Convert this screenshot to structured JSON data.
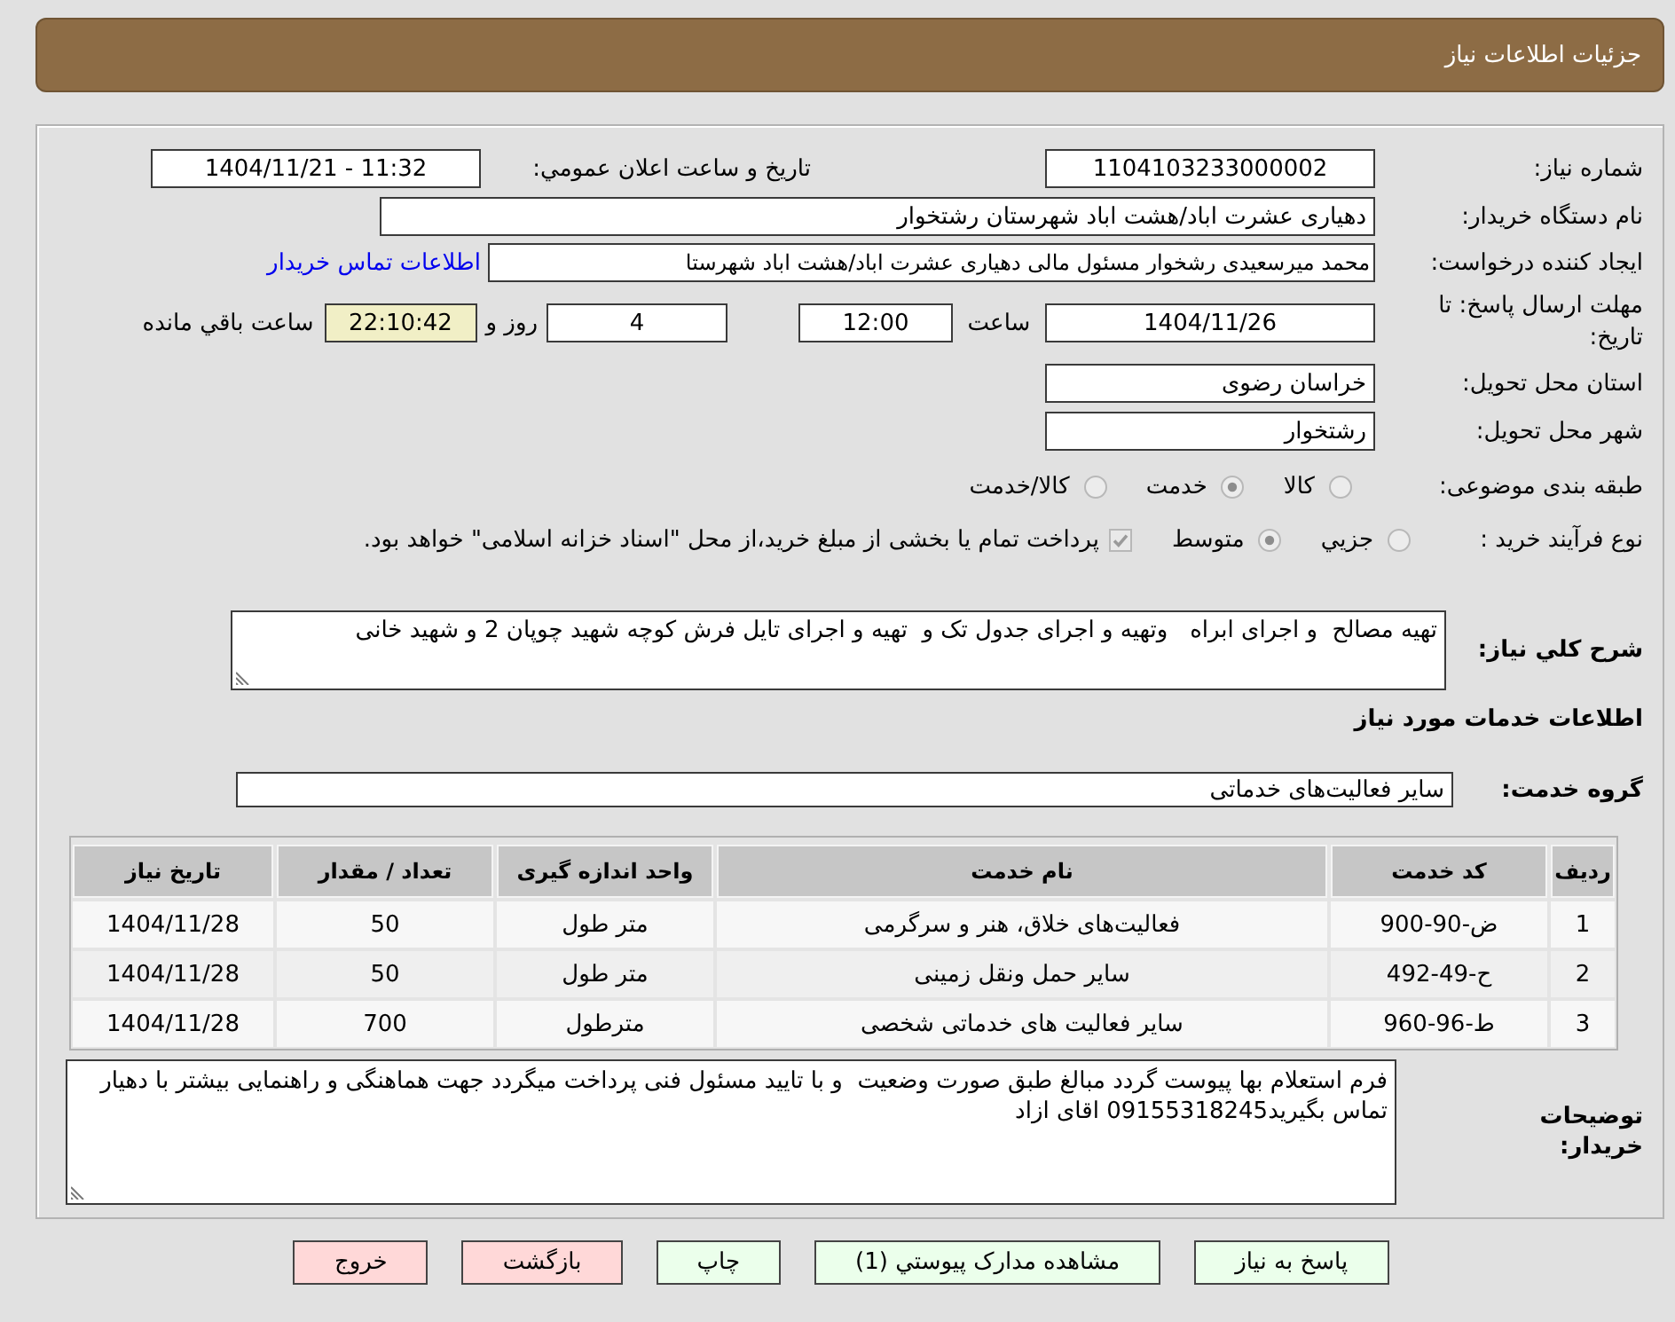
{
  "header": {
    "title": "جزئيات اطلاعات نياز"
  },
  "form": {
    "need_number": {
      "label": "شماره نياز:",
      "value": "1104103233000002"
    },
    "announce_datetime": {
      "label": "تاريخ و ساعت اعلان عمومي:",
      "value": "1404/11/21 - 11:32"
    },
    "buyer_org": {
      "label": "نام دستگاه خريدار:",
      "value": "دهياری عشرت اباد/هشت اباد شهرستان رشتخوار"
    },
    "requester": {
      "label": "ايجاد کننده درخواست:",
      "value": "محمد ميرسعيدی رشخوار مسئول مالی دهياری عشرت اباد/هشت اباد شهرستا",
      "contact_link": "اطلاعات تماس خريدار"
    },
    "deadline": {
      "label": "مهلت ارسال پاسخ: تا تاريخ:",
      "date": "1404/11/26",
      "time_label": "ساعت",
      "time": "12:00",
      "days": "4",
      "days_label": "روز و",
      "remaining_time": "22:10:42",
      "remaining_label": "ساعت باقي مانده"
    },
    "province": {
      "label": "استان محل تحويل:",
      "value": "خراسان رضوی"
    },
    "city": {
      "label": "شهر محل تحويل:",
      "value": "رشتخوار"
    },
    "category": {
      "label": "طبقه بندی موضوعی:",
      "disabled": true,
      "options": [
        {
          "label": "کالا",
          "selected": false
        },
        {
          "label": "خدمت",
          "selected": true
        },
        {
          "label": "کالا/خدمت",
          "selected": false
        }
      ]
    },
    "process": {
      "label": "نوع فرآيند خريد :",
      "disabled": true,
      "options": [
        {
          "label": "جزيي",
          "selected": false
        },
        {
          "label": "متوسط",
          "selected": true
        }
      ],
      "treasury": {
        "label": "پرداخت تمام يا بخشی از مبلغ خريد،از محل \"اسناد خزانه اسلامی\" خواهد بود.",
        "checked": true
      }
    },
    "description": {
      "label": "شرح کلي نياز:",
      "value": "تهيه مصالح  و اجرای ابراه   وتهيه و اجرای جدول تک و  تهيه و اجرای تايل فرش کوچه شهيد چوپان 2 و شهيد خانی"
    }
  },
  "services": {
    "title": "اطلاعات خدمات مورد نياز",
    "group": {
      "label": "گروه خدمت:",
      "value": "ساير فعاليت‌هاى خدماتى"
    },
    "table": {
      "columns": [
        "رديف",
        "کد خدمت",
        "نام خدمت",
        "واحد اندازه گيری",
        "تعداد / مقدار",
        "تاريخ نياز"
      ],
      "rows": [
        [
          "1",
          "ض-90-900",
          "فعاليت‌هاى خلاق، هنر و سرگرمى",
          "متر طول",
          "50",
          "1404/11/28"
        ],
        [
          "2",
          "ح-49-492",
          "ساير حمل ونقل زمينى",
          "متر طول",
          "50",
          "1404/11/28"
        ],
        [
          "3",
          "ط-96-960",
          "ساير فعاليت هاى خدماتى شخصى",
          "مترطول",
          "700",
          "1404/11/28"
        ]
      ]
    }
  },
  "buyer_notes": {
    "label": "توضيحات خريدار:",
    "value": "فرم استعلام بها پيوست گردد مبالغ طبق صورت وضعيت  و با تاييد مسئول فنی پرداخت ميگردد جهت هماهنگی و راهنمايی بيشتر با دهيار تماس بگيريد09155318245 اقای ازاد"
  },
  "buttons": [
    {
      "label": "پاسخ به نياز",
      "kind": "action"
    },
    {
      "label": "مشاهده مدارک پيوستي (1)",
      "kind": "action"
    },
    {
      "label": "چاپ",
      "kind": "action"
    },
    {
      "label": "بازگشت",
      "kind": "leave"
    },
    {
      "label": "خروج",
      "kind": "leave"
    }
  ]
}
